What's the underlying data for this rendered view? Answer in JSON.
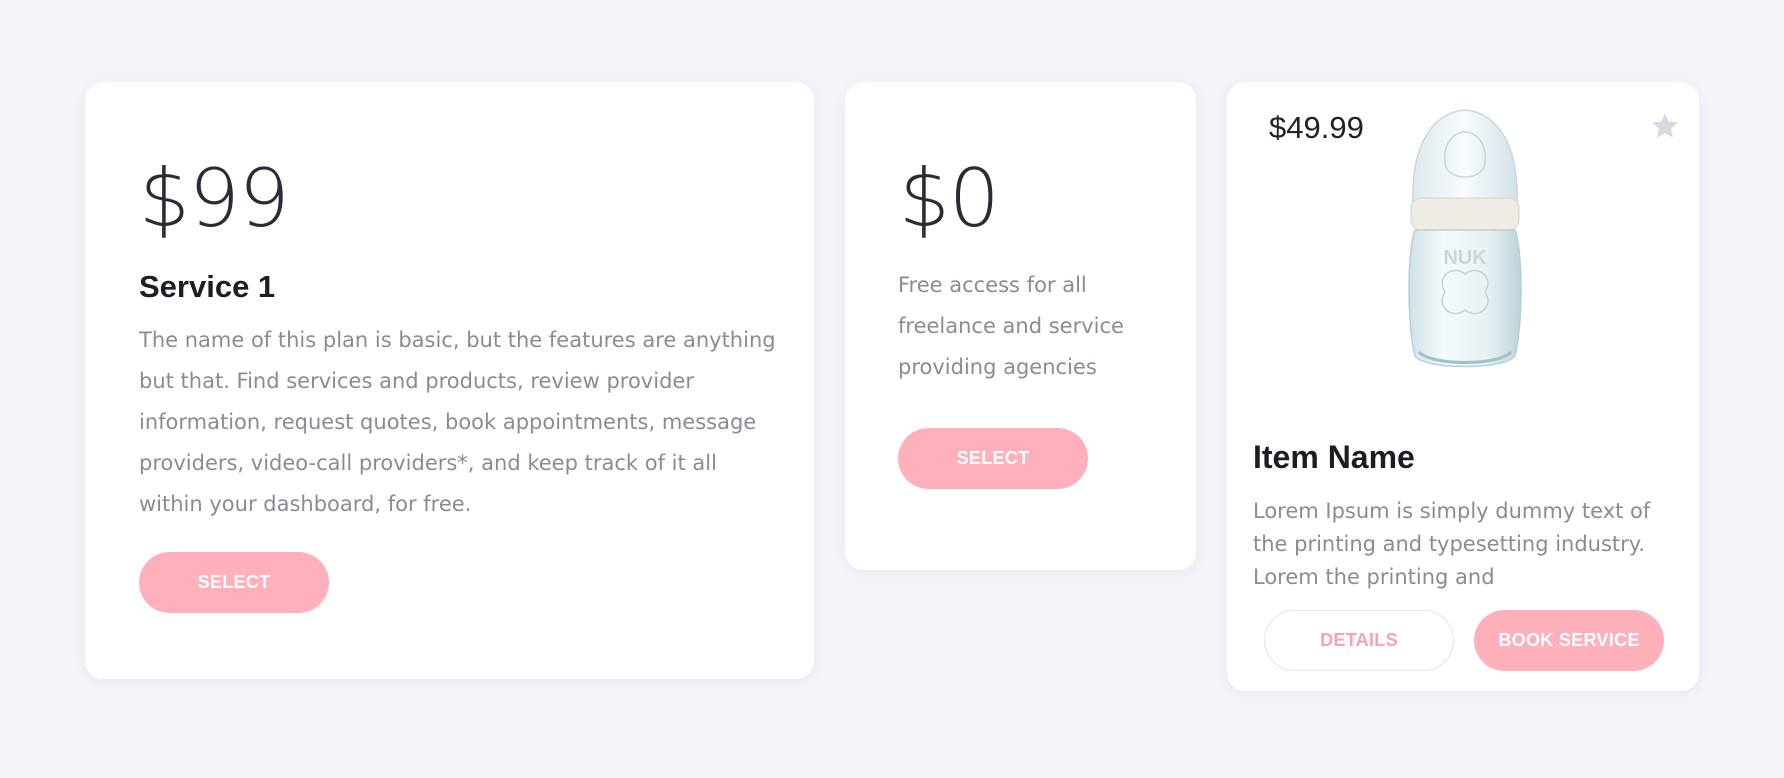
{
  "plans": [
    {
      "price": "$99",
      "title": "Service 1",
      "description": "The name of this plan is basic, but the features are anything but that. Find services and products, review provider information, request quotes, book appointments, message providers, video-call providers*, and keep track of it all within your dashboard, for free.",
      "button_label": "SELECT"
    },
    {
      "price": "$0",
      "description": "Free access for all freelance and service providing agencies",
      "button_label": "SELECT"
    }
  ],
  "item": {
    "price": "$49.99",
    "image_icon": "baby-bottle-image",
    "favorite_icon": "star-icon",
    "name": "Item Name",
    "description": "Lorem Ipsum is simply dummy text of the printing and typesetting industry. Lorem the printing and",
    "details_label": "DETAILS",
    "book_label": "BOOK SERVICE"
  },
  "colors": {
    "background": "#f4f3f8",
    "accent_pink": "#ffb0bb",
    "outline_text": "#f6a3b3"
  }
}
